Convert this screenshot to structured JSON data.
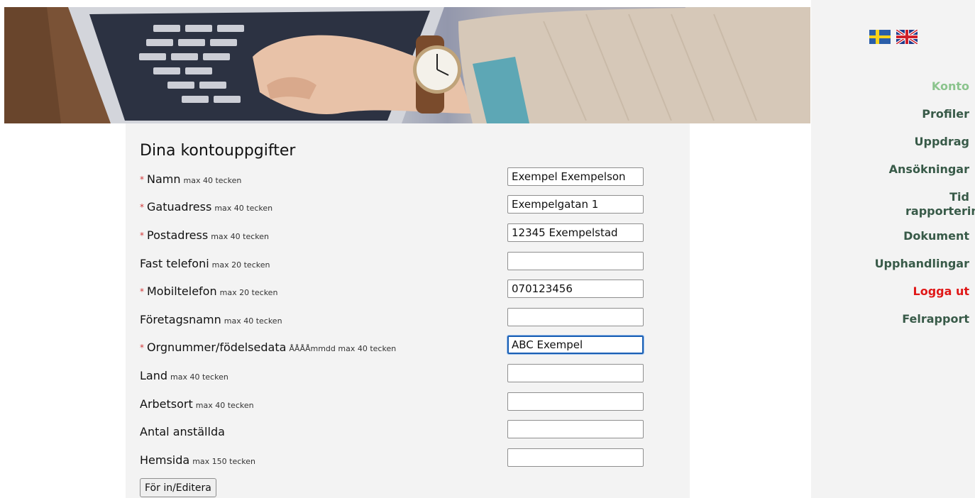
{
  "header": {
    "title": "Dina kontouppgifter"
  },
  "languages": [
    {
      "name": "swedish-flag-icon",
      "colors": {
        "blue": "#2a5ea9",
        "yellow": "#f8d21c"
      }
    },
    {
      "name": "uk-flag-icon",
      "colors": {
        "blue": "#1f3a8a",
        "red": "#cf1f2b",
        "white": "#ffffff"
      }
    }
  ],
  "nav": {
    "items": [
      {
        "label": "Konto",
        "state": "active"
      },
      {
        "label": "Profiler"
      },
      {
        "label": "Uppdrag"
      },
      {
        "label": "Ansökningar"
      },
      {
        "label": "Tid rapportering"
      },
      {
        "label": "Dokument"
      },
      {
        "label": "Upphandlingar"
      },
      {
        "label": "Logga ut",
        "state": "logout"
      },
      {
        "label": "Felrapport"
      }
    ],
    "colors": {
      "default": "#385a48",
      "active": "#8bc48d",
      "logout": "#e01818"
    }
  },
  "form": {
    "title": "Dina kontouppgifter",
    "required_marker": "*",
    "fields": [
      {
        "label": "Namn",
        "hint": "max 40 tecken",
        "required": true,
        "value": "Exempel Exempelson"
      },
      {
        "label": "Gatuadress",
        "hint": "max 40 tecken",
        "required": true,
        "value": "Exempelgatan 1"
      },
      {
        "label": "Postadress",
        "hint": "max 40 tecken",
        "required": true,
        "value": "12345 Exempelstad"
      },
      {
        "label": "Fast telefoni",
        "hint": "max 20 tecken",
        "required": false,
        "value": ""
      },
      {
        "label": "Mobiltelefon",
        "hint": "max 20 tecken",
        "required": true,
        "value": "070123456"
      },
      {
        "label": "Företagsnamn",
        "hint": "max 40 tecken",
        "required": false,
        "value": ""
      },
      {
        "label": "Orgnummer/födelsedata",
        "hint": "ÅÅÅÅmmdd max 40 tecken",
        "required": true,
        "value": "ABC Exempel",
        "focused": true
      },
      {
        "label": "Land",
        "hint": "max 40 tecken",
        "required": false,
        "value": ""
      },
      {
        "label": "Arbetsort",
        "hint": "max 40 tecken",
        "required": false,
        "value": ""
      },
      {
        "label": "Antal anställda",
        "hint": "",
        "required": false,
        "value": ""
      },
      {
        "label": "Hemsida",
        "hint": "max 150 tecken",
        "required": false,
        "value": ""
      }
    ],
    "submit_label": "För in/Editera"
  },
  "colors": {
    "panel_bg": "#f3f3f3",
    "required": "#d23a3a",
    "focus_border": "#1a5fb4"
  }
}
